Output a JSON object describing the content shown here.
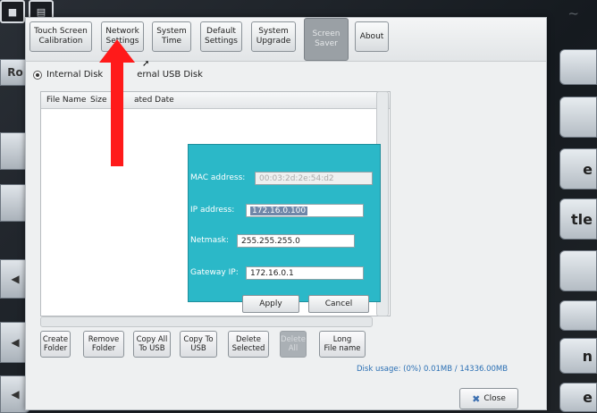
{
  "toolbar": {
    "buttons": [
      {
        "label": "Touch Screen\nCalibration"
      },
      {
        "label": "Network\nSettings"
      },
      {
        "label": "System\nTime"
      },
      {
        "label": "Default\nSettings"
      },
      {
        "label": "System\nUpgrade"
      },
      {
        "label": "Screen\nSaver"
      },
      {
        "label": "About"
      }
    ]
  },
  "storage": {
    "internal_label": "Internal Disk",
    "usb_label": "ernal USB Disk"
  },
  "file_list": {
    "columns": [
      "File Name",
      "Size",
      "ated Date"
    ]
  },
  "network": {
    "mac_label": "MAC address:",
    "mac_value": "00:03:2d:2e:54:d2",
    "ip_label": "IP address:",
    "ip_value": "172.16.0.100",
    "netmask_label": "Netmask:",
    "netmask_value": "255.255.255.0",
    "gateway_label": "Gateway IP:",
    "gateway_value": "172.16.0.1",
    "apply_label": "Apply",
    "cancel_label": "Cancel"
  },
  "bottom_buttons": [
    {
      "label": "Create\nFolder"
    },
    {
      "label": "Remove\nFolder"
    },
    {
      "label": "Copy All\nTo USB"
    },
    {
      "label": "Copy To\nUSB"
    },
    {
      "label": "Delete\nSelected"
    },
    {
      "label": "Delete\nAll"
    },
    {
      "label": "Long\nFile name"
    }
  ],
  "disk_usage": "Disk usage: (0%) 0.01MB / 14336.00MB",
  "close_label": "Close",
  "device": {
    "left_label": "Ro",
    "right_labels": [
      "e",
      "tle",
      "n",
      "e"
    ]
  },
  "colors": {
    "panel": "#2bb8c8",
    "arrow": "#ff1a1a",
    "link": "#2a6fb4"
  }
}
